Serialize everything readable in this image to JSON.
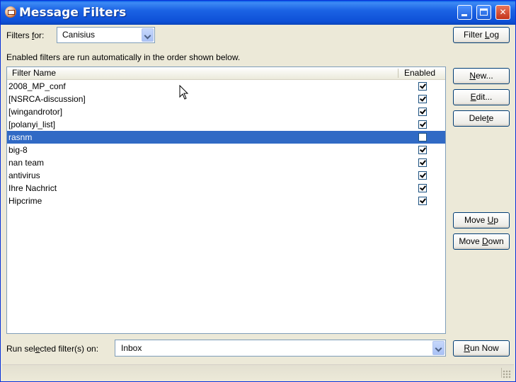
{
  "window": {
    "title": "Message Filters"
  },
  "filters_for": {
    "label_pre": "Filters ",
    "label_accel": "f",
    "label_post": "or:",
    "value": "Canisius"
  },
  "info_text": "Enabled filters are run automatically in the order shown below.",
  "columns": {
    "name": "Filter Name",
    "enabled": "Enabled"
  },
  "filters": [
    {
      "name": "2008_MP_conf",
      "enabled": true
    },
    {
      "name": "[NSRCA-discussion]",
      "enabled": true
    },
    {
      "name": "[wingandrotor]",
      "enabled": true
    },
    {
      "name": "[polanyi_list]",
      "enabled": true
    },
    {
      "name": "rasnm",
      "enabled": false,
      "selected": true
    },
    {
      "name": "big-8",
      "enabled": true
    },
    {
      "name": "nan team",
      "enabled": true
    },
    {
      "name": "antivirus",
      "enabled": true
    },
    {
      "name": "Ihre Nachrict",
      "enabled": true
    },
    {
      "name": "Hipcrime",
      "enabled": true
    }
  ],
  "buttons": {
    "filter_log": {
      "pre": "Filter ",
      "accel": "L",
      "post": "og"
    },
    "new": {
      "pre": "",
      "accel": "N",
      "post": "ew..."
    },
    "edit": {
      "pre": "",
      "accel": "E",
      "post": "dit..."
    },
    "delete": {
      "pre": "Dele",
      "accel": "t",
      "post": "e"
    },
    "move_up": {
      "pre": "Move ",
      "accel": "U",
      "post": "p"
    },
    "move_down": {
      "pre": "Move ",
      "accel": "D",
      "post": "own"
    },
    "run_now": {
      "pre": "",
      "accel": "R",
      "post": "un Now"
    }
  },
  "run_on": {
    "label_pre": "Run sel",
    "label_accel": "e",
    "label_post": "cted filter(s) on:",
    "value": "Inbox"
  },
  "colors": {
    "selection": "#316ac5",
    "titlebar": "#0d4fd6"
  }
}
